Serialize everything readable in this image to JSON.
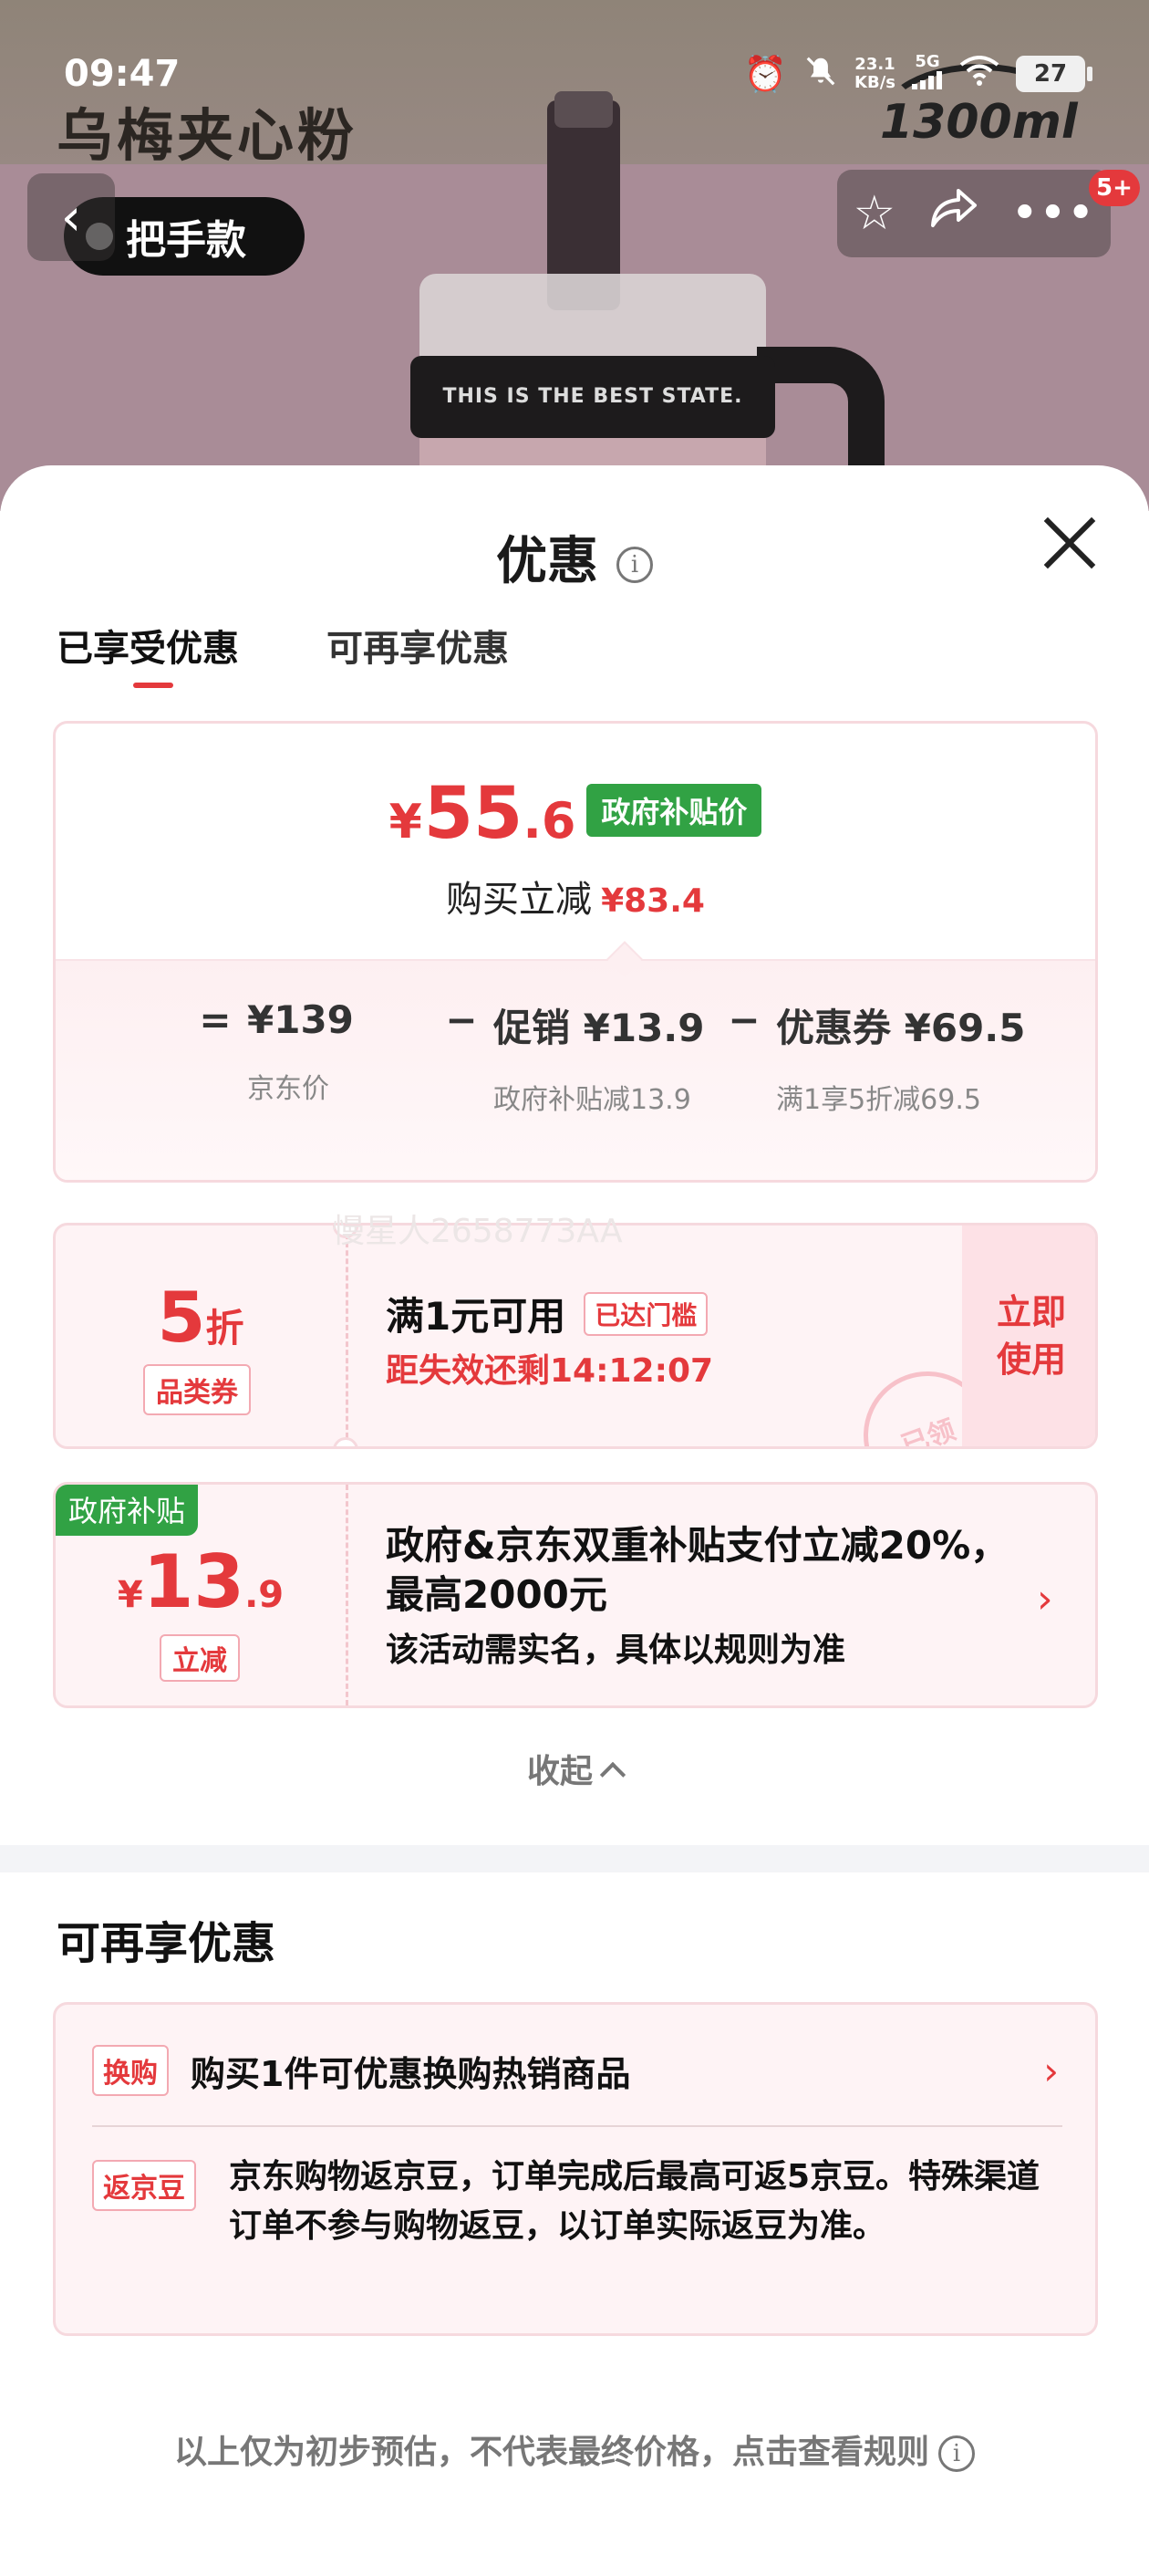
{
  "status_bar": {
    "time": "09:47",
    "speed_value": "23.1",
    "speed_unit": "KB/s",
    "network": "5G",
    "battery": "27"
  },
  "product_hero": {
    "title": "乌梅夹心粉",
    "badge": "把手款",
    "capacity": "1300ml",
    "ring_text": "THIS IS THE BEST STATE.",
    "notification_count": "5+"
  },
  "sheet": {
    "title": "优惠",
    "tabs": [
      {
        "label": "已享受优惠",
        "active": true
      },
      {
        "label": "可再享优惠",
        "active": false
      }
    ]
  },
  "price_card": {
    "currency": "¥",
    "price_int": "55",
    "price_frac": ".6",
    "gov_tag": "政府补贴价",
    "reduce_label": "购买立减",
    "reduce_amount": "¥83.4",
    "formula": {
      "eq": "=",
      "op1": "−",
      "op2": "−",
      "t1_value": "¥139",
      "t1_label": "京东价",
      "t2_value": "促销 ¥13.9",
      "t2_label": "政府补贴减13.9",
      "t3_value": "优惠券 ¥69.5",
      "t3_label": "满1享5折减69.5"
    }
  },
  "coupon": {
    "discount_num": "5",
    "discount_unit": "折",
    "category_tag": "品类券",
    "condition": "满1元可用",
    "reached_tag": "已达门槛",
    "expire_text": "距失效还剩14:12:07",
    "use_button": "立即使用",
    "stamp": "已领",
    "watermark": "慢星人2658773AA"
  },
  "gov_card": {
    "label": "政府补贴",
    "yen": "¥",
    "amount_int": "13",
    "amount_frac": ".9",
    "tag": "立减",
    "text": "政府&京东双重补贴支付立减20%，最高2000元",
    "note": "该活动需实名，具体以规则为准"
  },
  "collapse_label": "收起",
  "more_section": {
    "title": "可再享优惠",
    "items": [
      {
        "chip": "换购",
        "text": "购买1件可优惠换购热销商品"
      },
      {
        "chip": "返京豆",
        "text": "京东购物返京豆，订单完成后最高可返5京豆。特殊渠道订单不参与购物返豆，以订单实际返豆为准。"
      }
    ]
  },
  "footer_note": "以上仅为初步预估，不代表最终价格，点击查看规则",
  "colors": {
    "accent_red": "#e4393c",
    "gov_green": "#31a244",
    "card_bg": "#fef3f5"
  }
}
